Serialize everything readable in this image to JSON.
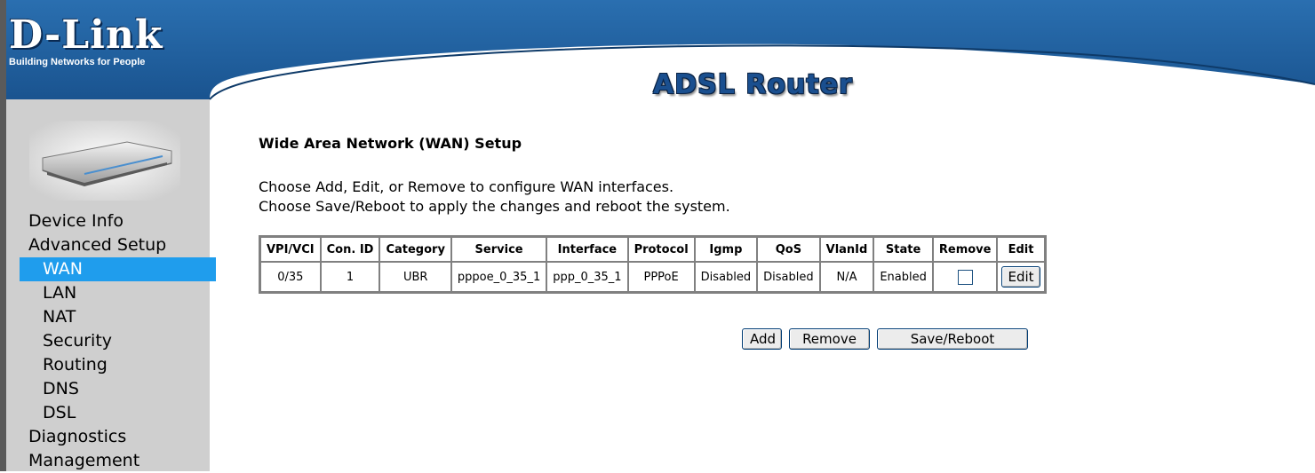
{
  "header": {
    "brand": "D-Link",
    "tagline": "Building Networks for People",
    "product_title": "ADSL Router",
    "colors": {
      "banner": "#1c5c9c",
      "banner_edge": "#0f3f72",
      "sidebar": "#cfcfcf",
      "active_nav": "#1f9ded"
    }
  },
  "sidebar": {
    "device_image": "adsl-router-device",
    "items": [
      {
        "label": "Device Info",
        "level": 0,
        "active": false
      },
      {
        "label": "Advanced Setup",
        "level": 0,
        "active": false
      },
      {
        "label": "WAN",
        "level": 1,
        "active": true
      },
      {
        "label": "LAN",
        "level": 1,
        "active": false
      },
      {
        "label": "NAT",
        "level": 1,
        "active": false
      },
      {
        "label": "Security",
        "level": 1,
        "active": false
      },
      {
        "label": "Routing",
        "level": 1,
        "active": false
      },
      {
        "label": "DNS",
        "level": 1,
        "active": false
      },
      {
        "label": "DSL",
        "level": 1,
        "active": false
      },
      {
        "label": "Diagnostics",
        "level": 0,
        "active": false
      },
      {
        "label": "Management",
        "level": 0,
        "active": false
      }
    ]
  },
  "main": {
    "title": "Wide Area Network (WAN) Setup",
    "desc_line1": "Choose Add, Edit, or Remove to configure WAN interfaces.",
    "desc_line2": "Choose Save/Reboot to apply the changes and reboot the system.",
    "table": {
      "headers": [
        "VPI/VCI",
        "Con. ID",
        "Category",
        "Service",
        "Interface",
        "Protocol",
        "Igmp",
        "QoS",
        "VlanId",
        "State",
        "Remove",
        "Edit"
      ],
      "rows": [
        {
          "vpi_vci": "0/35",
          "con_id": "1",
          "category": "UBR",
          "service": "pppoe_0_35_1",
          "interface": "ppp_0_35_1",
          "protocol": "PPPoE",
          "igmp": "Disabled",
          "qos": "Disabled",
          "vlan_id": "N/A",
          "state": "Enabled",
          "remove_checked": false,
          "edit_label": "Edit"
        }
      ]
    },
    "buttons": {
      "add": "Add",
      "remove": "Remove",
      "save_reboot": "Save/Reboot"
    }
  }
}
